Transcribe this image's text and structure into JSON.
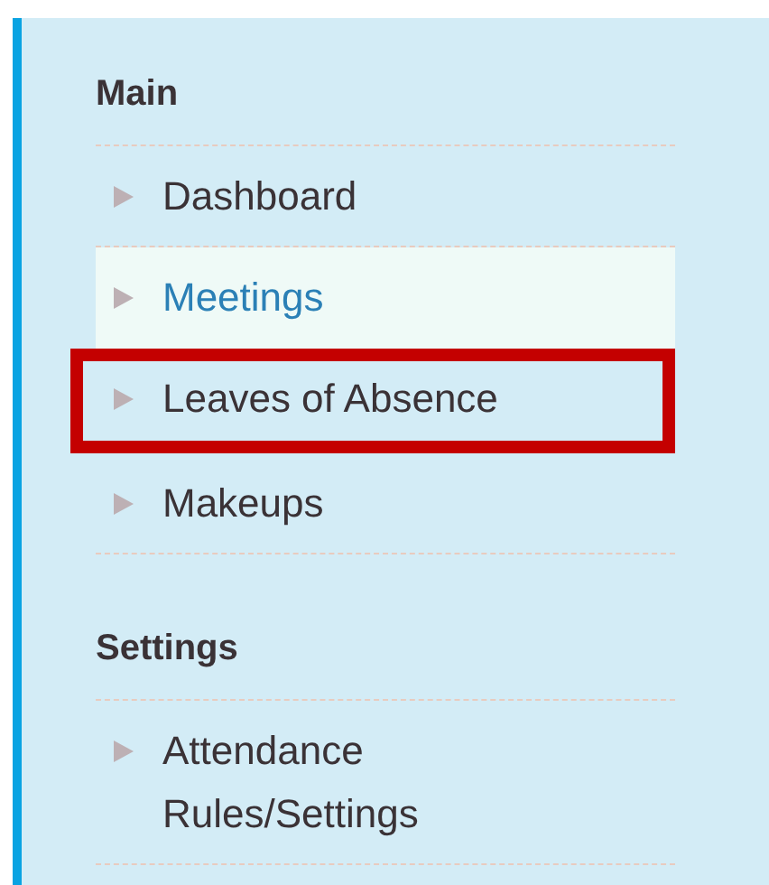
{
  "sections": [
    {
      "title": "Main",
      "items": [
        {
          "label": "Dashboard",
          "selected": false,
          "outlined": false
        },
        {
          "label": "Meetings",
          "selected": true,
          "outlined": false
        },
        {
          "label": "Leaves of Absence",
          "selected": false,
          "outlined": true
        },
        {
          "label": "Makeups",
          "selected": false,
          "outlined": false
        }
      ]
    },
    {
      "title": "Settings",
      "items": [
        {
          "label": "Attendance Rules/Settings",
          "selected": false,
          "outlined": false
        }
      ]
    }
  ]
}
